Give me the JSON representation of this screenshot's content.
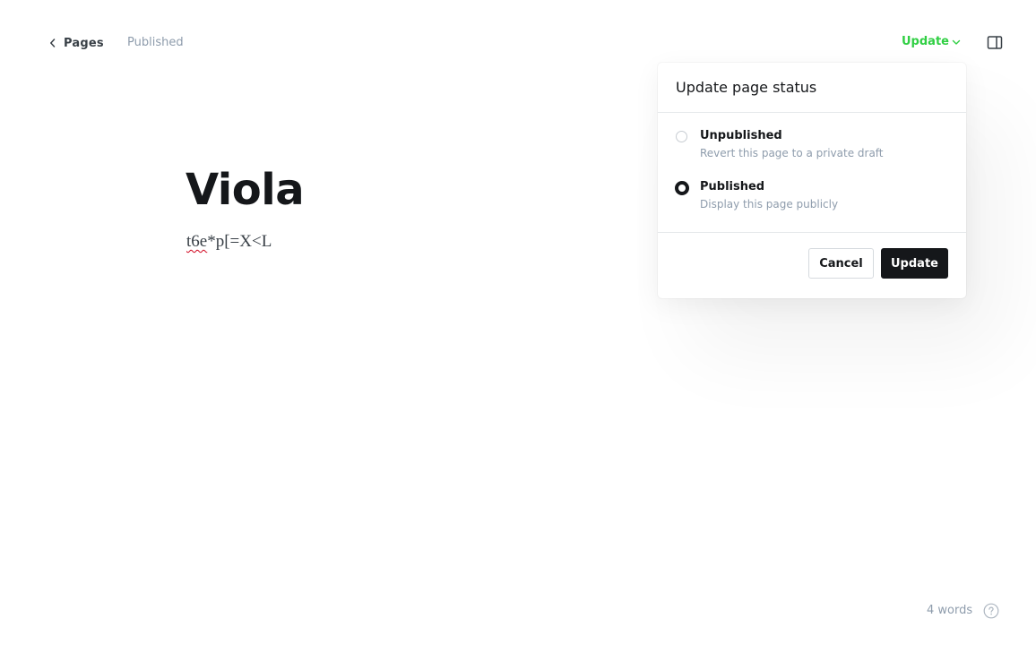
{
  "header": {
    "back_label": "Pages",
    "status": "Published",
    "update_label": "Update"
  },
  "editor": {
    "title": "Viola",
    "body_misspelled": "t6e",
    "body_rest": "*p[=X<L"
  },
  "popover": {
    "title": "Update page status",
    "options": [
      {
        "label": "Unpublished",
        "description": "Revert this page to a private draft",
        "selected": false
      },
      {
        "label": "Published",
        "description": "Display this page publicly",
        "selected": true
      }
    ],
    "cancel_label": "Cancel",
    "update_label": "Update"
  },
  "footer": {
    "word_count": "4 words"
  },
  "icons": {
    "back": "chevron-left-icon",
    "dropdown": "chevron-down-icon",
    "sidebar": "sidebar-toggle-icon",
    "help": "question-circle-icon"
  },
  "colors": {
    "accent": "#30cf43",
    "primary_button": "#15171a",
    "muted_text": "#8e9cac"
  }
}
